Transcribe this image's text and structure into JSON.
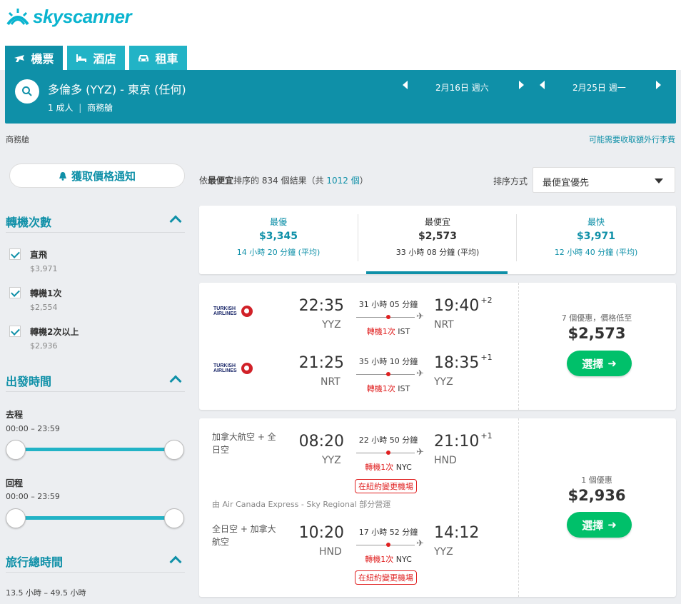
{
  "brand": {
    "name": "skyscanner",
    "color": "#0ab4cf"
  },
  "tabs": [
    {
      "label": "機票",
      "icon": "plane-icon",
      "active": true
    },
    {
      "label": "酒店",
      "icon": "bed-icon",
      "active": false
    },
    {
      "label": "租車",
      "icon": "car-icon",
      "active": false
    }
  ],
  "search": {
    "route": "多倫多 (YYZ) - 東京 (任何)",
    "passengers": "1 成人",
    "cabin": "商務艙",
    "outbound_date": "2月16日 週六",
    "return_date": "2月25日 週一"
  },
  "notes": {
    "cabin": "商務艙",
    "baggage": "可能需要收取額外行李費"
  },
  "sidebar": {
    "alert_button": "獲取價格通知",
    "stops": {
      "title": "轉機次數",
      "options": [
        {
          "label": "直飛",
          "price": "$3,971",
          "checked": true
        },
        {
          "label": "轉機1次",
          "price": "$2,554",
          "checked": true
        },
        {
          "label": "轉機2次以上",
          "price": "$2,936",
          "checked": true
        }
      ]
    },
    "departure": {
      "title": "出發時間",
      "outbound_label": "去程",
      "outbound_range": "00:00 – 23:59",
      "return_label": "回程",
      "return_range": "00:00 – 23:59"
    },
    "duration": {
      "title": "旅行總時間",
      "range": "13.5 小時 – 49.5 小時"
    }
  },
  "results": {
    "prefix": "依",
    "sort_bold": "最便宜",
    "middle": "排序的 834 個結果（共 ",
    "total": "1012 個",
    "suffix": "）",
    "sort_label": "排序方式",
    "sort_value": "最便宜優先"
  },
  "summary": [
    {
      "label": "最優",
      "price": "$3,345",
      "duration": "14 小時 20 分鐘 (平均)",
      "selected": false
    },
    {
      "label": "最便宜",
      "price": "$2,573",
      "duration": "33 小時 08 分鐘 (平均)",
      "selected": true
    },
    {
      "label": "最快",
      "price": "$3,971",
      "duration": "12 小時 40 分鐘 (平均)",
      "selected": false
    }
  ],
  "cards": [
    {
      "legs": [
        {
          "airline": "TURKISH AIRLINES",
          "dep": "22:35",
          "dep_code": "YYZ",
          "duration": "31 小時 05 分鐘",
          "stops": "轉機1次",
          "via": "IST",
          "arr": "19:40",
          "arr_offset": "+2",
          "arr_code": "NRT"
        },
        {
          "airline": "TURKISH AIRLINES",
          "dep": "21:25",
          "dep_code": "NRT",
          "duration": "35 小時 10 分鐘",
          "stops": "轉機1次",
          "via": "IST",
          "arr": "18:35",
          "arr_offset": "+1",
          "arr_code": "YYZ"
        }
      ],
      "deals": "7 個優惠，價格低至",
      "price": "$2,573",
      "select": "選擇"
    },
    {
      "legs": [
        {
          "airline": "加拿大航空 + 全日空",
          "dep": "08:20",
          "dep_code": "YYZ",
          "duration": "22 小時 50 分鐘",
          "stops": "轉機1次",
          "via": "NYC",
          "warning": "在紐約變更機場",
          "arr": "21:10",
          "arr_offset": "+1",
          "arr_code": "HND"
        },
        {
          "airline": "全日空 + 加拿大航空",
          "dep": "10:20",
          "dep_code": "HND",
          "duration": "17 小時 52 分鐘",
          "stops": "轉機1次",
          "via": "NYC",
          "warning": "在紐約變更機場",
          "arr": "14:12",
          "arr_offset": "",
          "arr_code": "YYZ"
        }
      ],
      "operated": "由 Air Canada Express - Sky Regional 部分營運",
      "deals": "1 個優惠",
      "price": "$2,936",
      "select": "選擇"
    }
  ]
}
